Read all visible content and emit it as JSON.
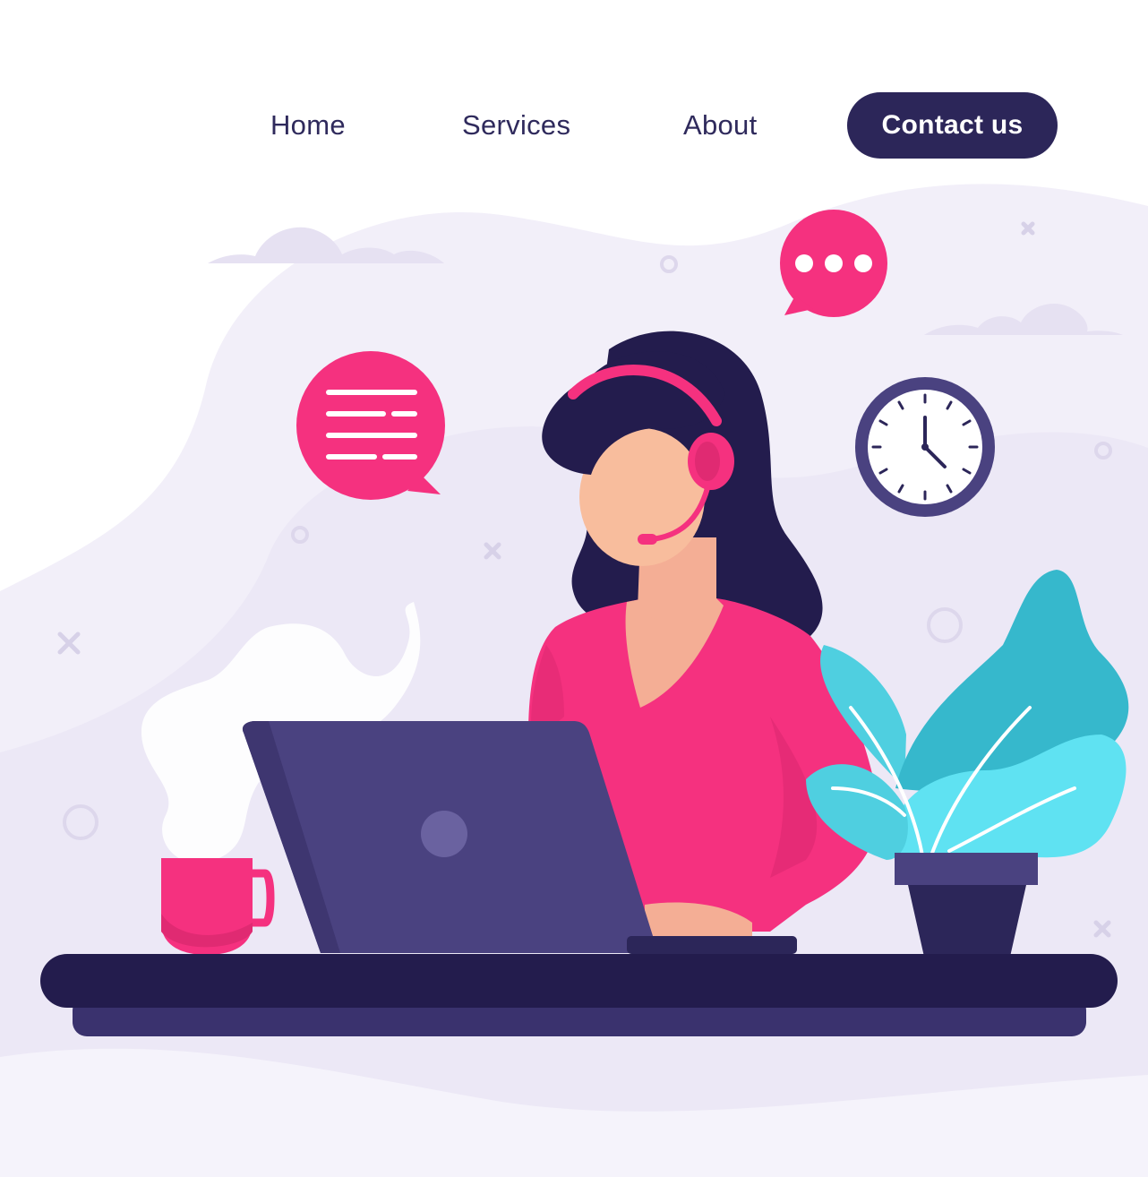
{
  "nav": {
    "items": [
      {
        "label": "Home"
      },
      {
        "label": "Services"
      },
      {
        "label": "About"
      }
    ],
    "cta_label": "Contact us"
  },
  "colors": {
    "navy": "#2c2659",
    "pink": "#f5317f",
    "laptop": "#4a4280",
    "teal": "#3fc7dd",
    "background_blob": "#f0edf8"
  },
  "icons": [
    "text-message-bubble-icon",
    "typing-dots-bubble-icon",
    "wall-clock-icon",
    "headset-icon",
    "coffee-mug-icon",
    "laptop-icon",
    "potted-plant-icon"
  ]
}
